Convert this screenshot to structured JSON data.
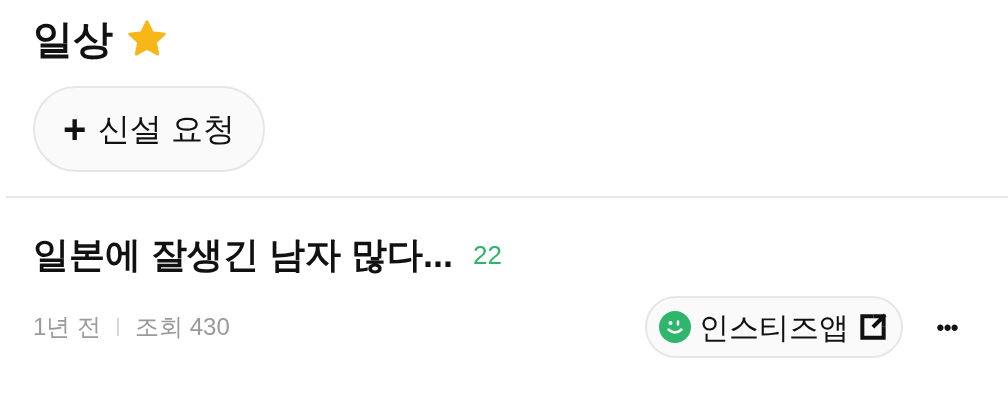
{
  "board": {
    "title": "일상"
  },
  "request_button": {
    "icon": "+",
    "label": "신설 요청"
  },
  "post": {
    "title": "일본에 잘생긴 남자 많다...",
    "comment_count": "22",
    "time": "1년 전",
    "views": "조회 430",
    "app_link": "인스티즈앱",
    "more": "•••"
  }
}
